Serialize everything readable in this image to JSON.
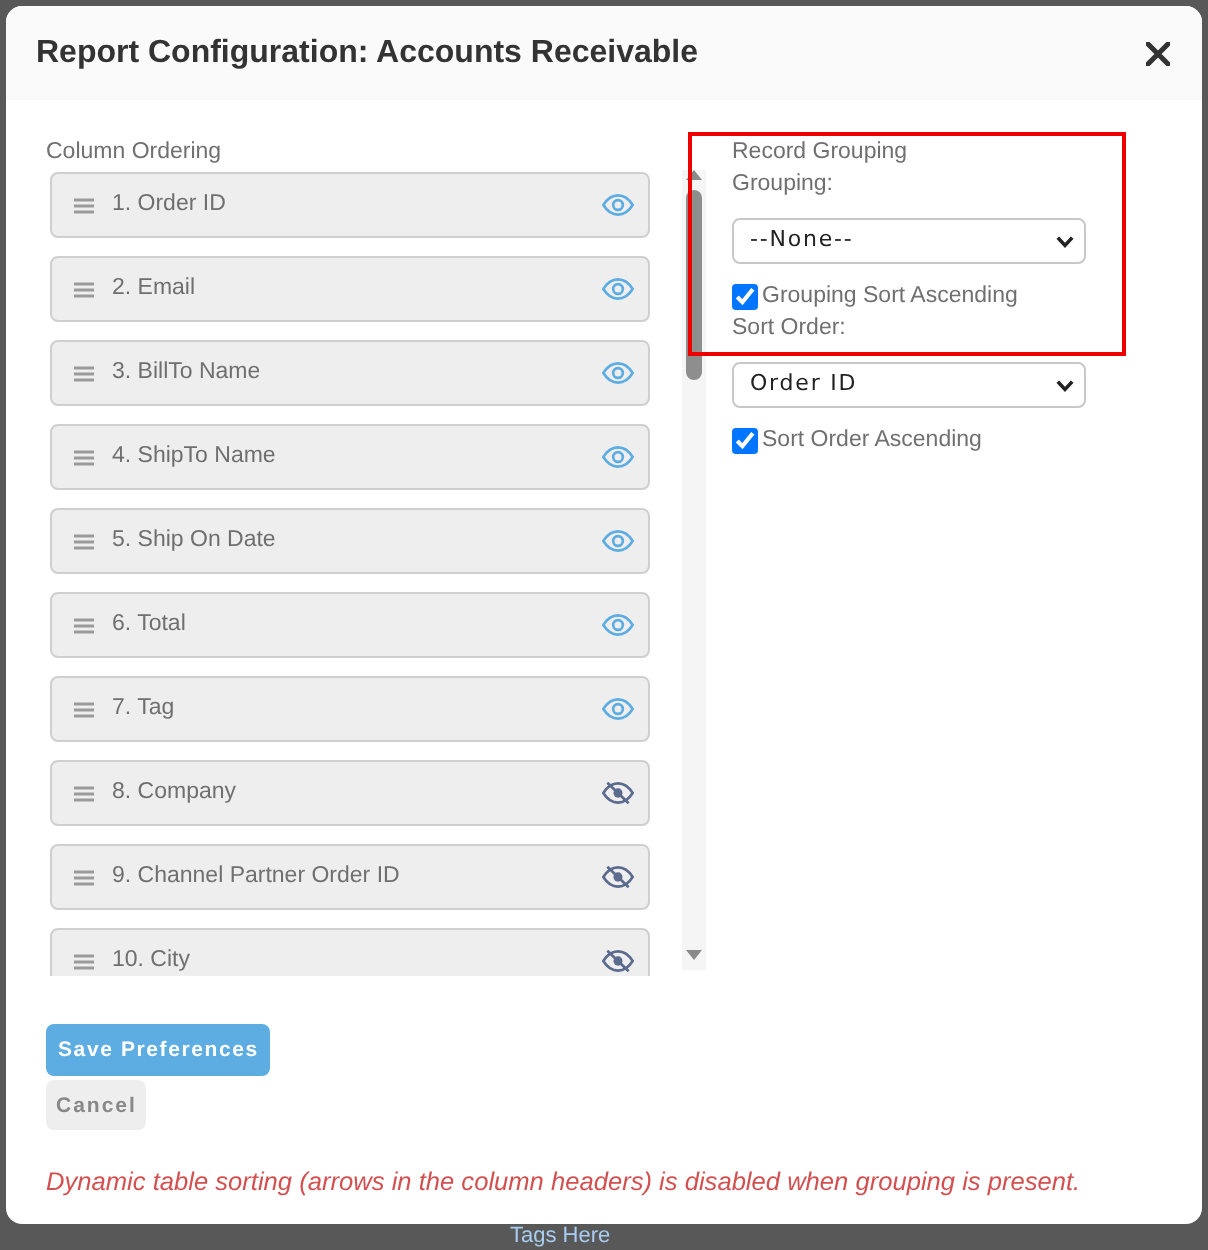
{
  "dialog": {
    "title": "Report Configuration: Accounts Receivable"
  },
  "column_ordering": {
    "label": "Column Ordering",
    "columns": [
      {
        "label": "1. Order ID",
        "visible": true
      },
      {
        "label": "2. Email",
        "visible": true
      },
      {
        "label": "3. BillTo Name",
        "visible": true
      },
      {
        "label": "4. ShipTo Name",
        "visible": true
      },
      {
        "label": "5. Ship On Date",
        "visible": true
      },
      {
        "label": "6. Total",
        "visible": true
      },
      {
        "label": "7. Tag",
        "visible": true
      },
      {
        "label": "8. Company",
        "visible": false
      },
      {
        "label": "9. Channel Partner Order ID",
        "visible": false
      },
      {
        "label": "10. City",
        "visible": false
      }
    ]
  },
  "record_grouping": {
    "highlighted": true,
    "heading": "Record Grouping",
    "grouping_label": "Grouping:",
    "grouping_value": "--None--",
    "grouping_ascending": {
      "label": "Grouping Sort Ascending",
      "checked": true
    },
    "sort_order_label": "Sort Order:",
    "sort_order_value": "Order ID",
    "sort_ascending": {
      "label": "Sort Order Ascending",
      "checked": true
    }
  },
  "buttons": {
    "save": "Save Preferences",
    "cancel": "Cancel"
  },
  "note": "Dynamic table sorting (arrows in the column headers) is disabled when grouping is present.",
  "background_page": {
    "link_text": "Tags Here"
  }
}
